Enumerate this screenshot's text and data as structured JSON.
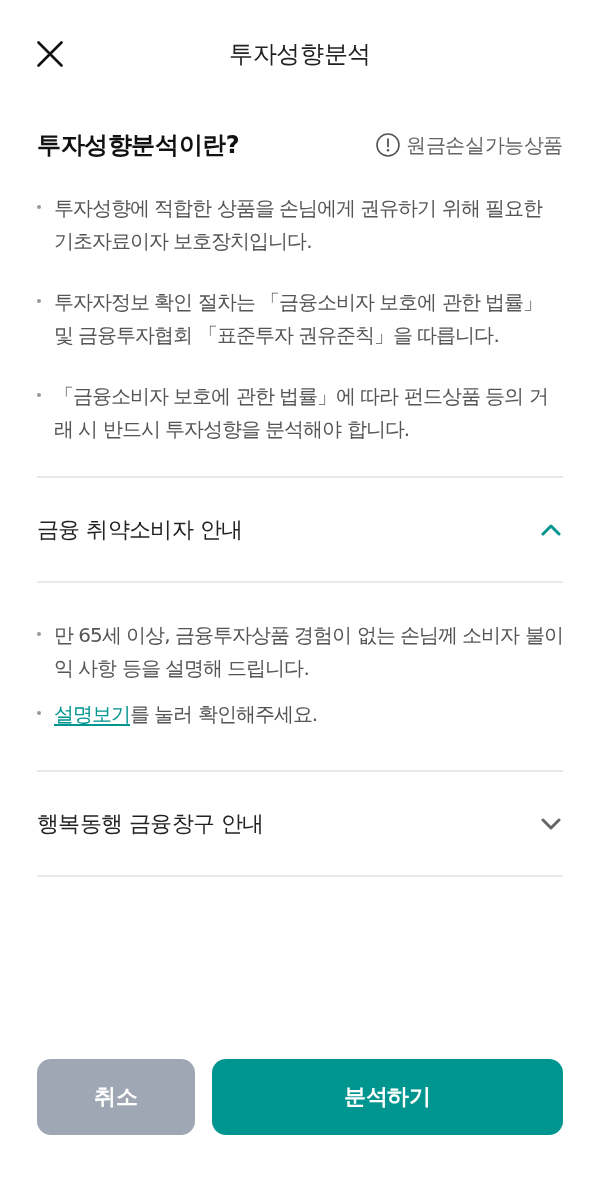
{
  "header": {
    "title": "투자성향분석"
  },
  "intro": {
    "title": "투자성향분석이란?",
    "notice": "원금손실가능상품",
    "bullets": [
      "투자성향에 적합한 상품을 손님에게 권유하기 위해 필요한 기초자료이자 보호장치입니다.",
      "투자자정보 확인 절차는 「금융소비자 보호에 관한 법률」 및 금융투자협회 「표준투자 권유준칙」을 따릅니다.",
      "「금융소비자 보호에 관한 법률」에 따라 펀드상품 등의 거래 시 반드시 투자성향을 분석해야 합니다."
    ]
  },
  "accordions": [
    {
      "title": "금융 취약소비자 안내",
      "expanded": true,
      "bullets": [
        {
          "kind": "text",
          "text": "만 65세 이상, 금융투자상품 경험이 없는 손님께 소비자 불이익 사항 등을 설명해 드립니다."
        },
        {
          "kind": "link",
          "link": "설명보기",
          "text": "를 눌러 확인해주세요."
        }
      ]
    },
    {
      "title": "행복동행 금융창구 안내",
      "expanded": false
    }
  ],
  "buttons": [
    {
      "label": "취소",
      "kind": "secondary"
    },
    {
      "label": "분석하기",
      "kind": "primary"
    }
  ]
}
